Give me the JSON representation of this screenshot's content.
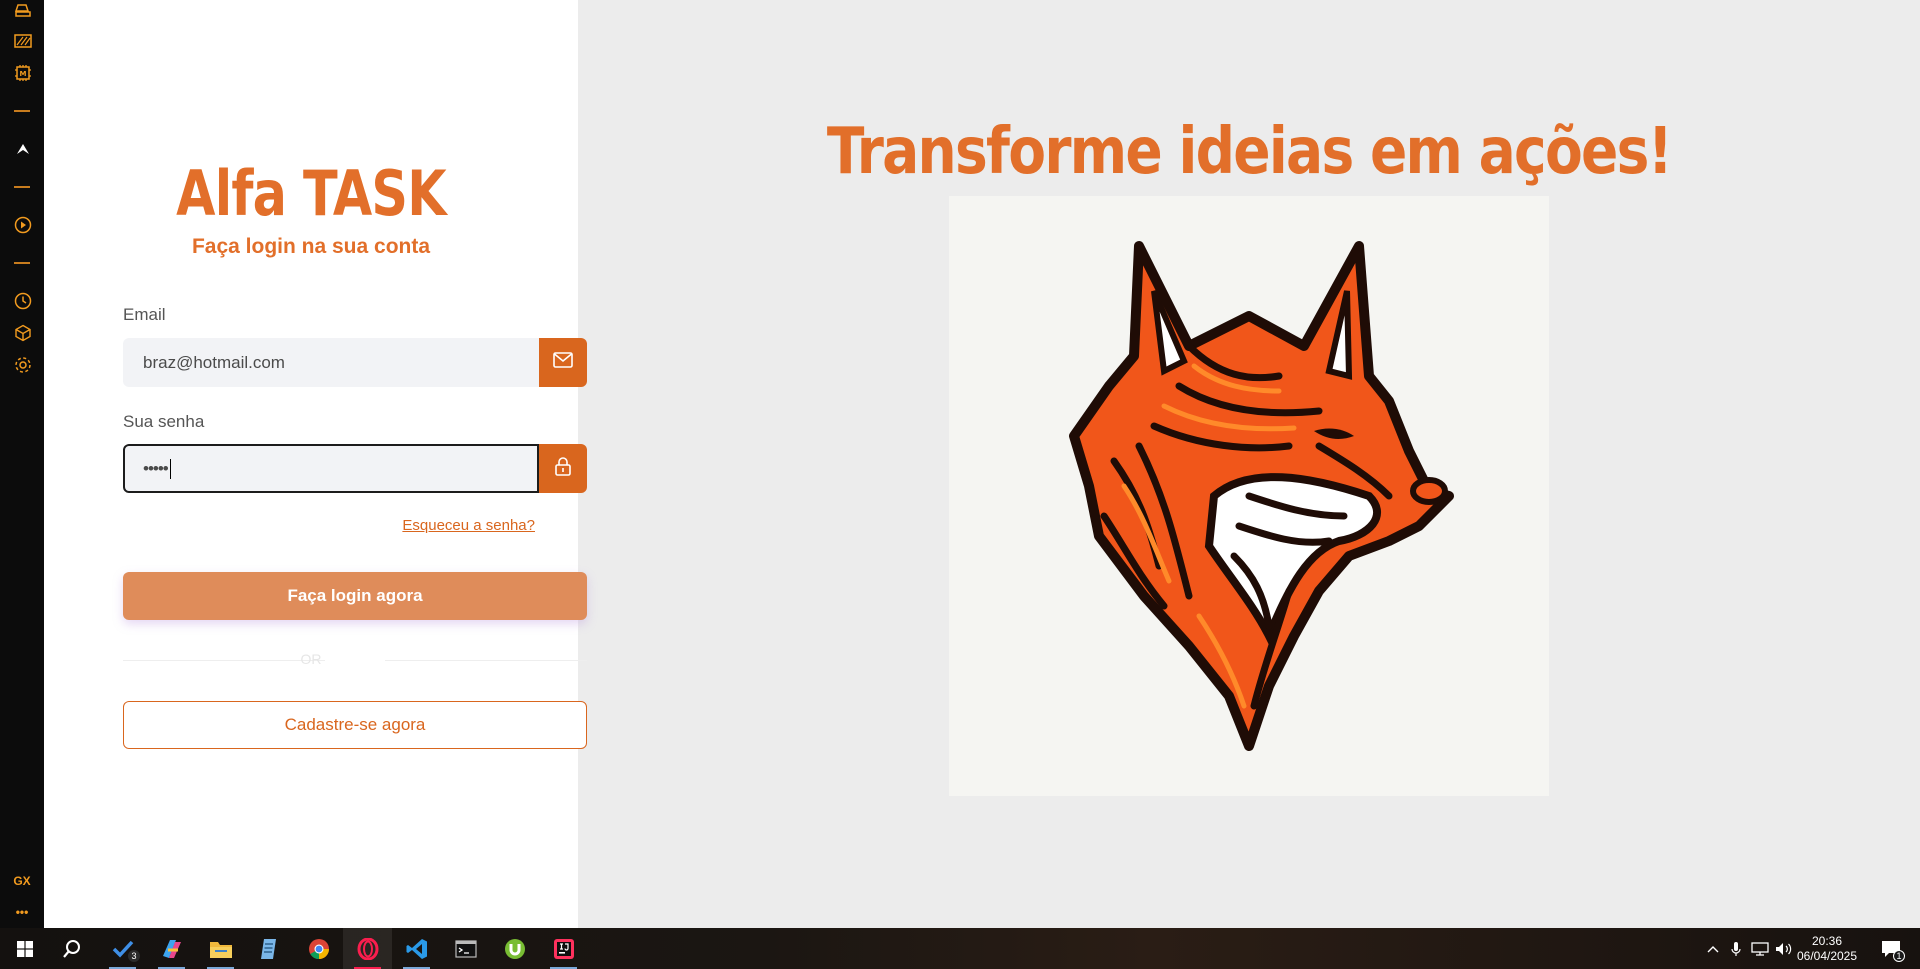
{
  "sidebar": {
    "bottom_label": "GX",
    "more_label": "•••",
    "accent": "#f29b1f",
    "icons": [
      "printer-icon",
      "stripes-icon",
      "memory-chip-icon",
      "wing-logo-icon",
      "play-circle-icon",
      "clock-icon",
      "cube-icon",
      "gear-icon"
    ]
  },
  "login": {
    "title": "Alfa TASK",
    "subtitle": "Faça login na sua conta",
    "email_label": "Email",
    "email_value": "braz@hotmail.com",
    "password_label": "Sua senha",
    "password_value": "•••••",
    "forgot_link": "Esqueceu a senha?",
    "login_button": "Faça login agora",
    "or_text": "OR",
    "signup_button": "Cadastre-se agora"
  },
  "hero": {
    "title": "Transforme ideias em ações!",
    "image": "fox-head-illustration"
  },
  "taskbar": {
    "apps": [
      "start-icon",
      "search-icon",
      "todo-icon",
      "copilot-icon",
      "file-explorer-icon",
      "notepad-icon",
      "chrome-icon",
      "opera-gx-icon",
      "vscode-icon",
      "terminal-icon",
      "utorrent-icon",
      "intellij-icon"
    ],
    "todo_badge": "3",
    "time": "20:36",
    "date": "06/04/2025",
    "notification_count": "1"
  },
  "colors": {
    "brand": "#e26f2a",
    "button": "#df8c5a",
    "icon_button": "#d9661e"
  }
}
